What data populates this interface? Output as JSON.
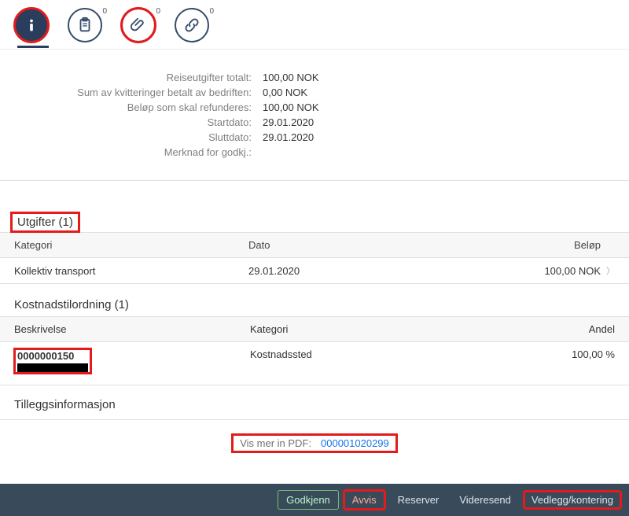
{
  "tabs": {
    "info_badge": "",
    "notes_badge": "0",
    "attach_badge": "0",
    "link_badge": "0"
  },
  "summary": [
    {
      "label": "Reiseutgifter totalt:",
      "value": "100,00  NOK"
    },
    {
      "label": "Sum av kvitteringer betalt av bedriften:",
      "value": "0,00  NOK"
    },
    {
      "label": "Beløp som skal refunderes:",
      "value": "100,00  NOK"
    },
    {
      "label": "Startdato:",
      "value": "29.01.2020"
    },
    {
      "label": "Sluttdato:",
      "value": "29.01.2020"
    },
    {
      "label": "Merknad for godkj.:",
      "value": ""
    }
  ],
  "utgifter": {
    "title": "Utgifter (1)",
    "headers": {
      "a": "Kategori",
      "b": "Dato",
      "c": "Beløp"
    },
    "row": {
      "a": "Kollektiv transport",
      "b": "29.01.2020",
      "c": "100,00  NOK"
    }
  },
  "kostnad": {
    "title": "Kostnadstilordning (1)",
    "headers": {
      "a": "Beskrivelse",
      "b": "Kategori",
      "c": "Andel"
    },
    "row": {
      "id": "0000000150",
      "b": "Kostnadssted",
      "c": "100,00 %"
    }
  },
  "tillegg": {
    "title": "Tilleggsinformasjon",
    "pdf_label": "Vis mer in PDF:",
    "pdf_link": "000001020299"
  },
  "footer": {
    "approve": "Godkjenn",
    "reject": "Avvis",
    "reserve": "Reserver",
    "forward": "Videresend",
    "attach": "Vedlegg/kontering"
  }
}
